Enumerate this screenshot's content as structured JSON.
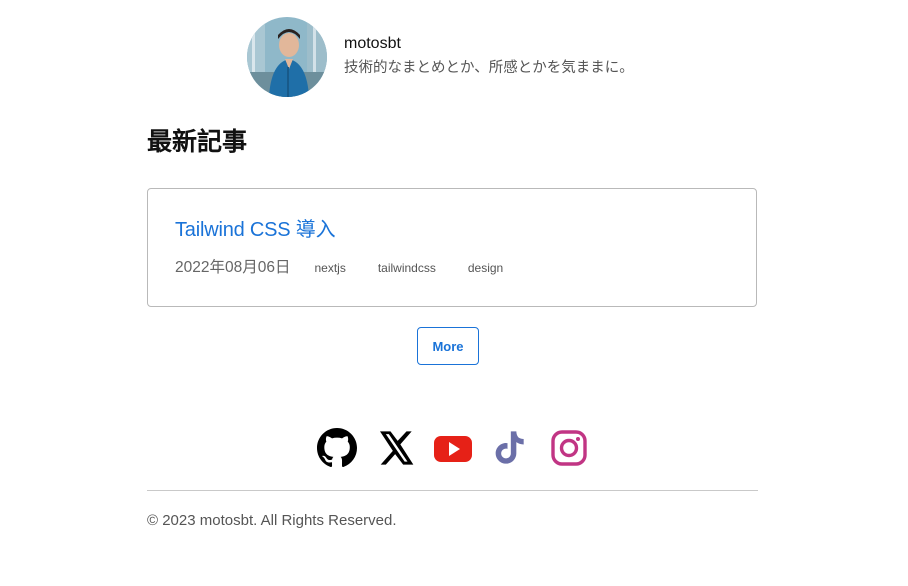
{
  "profile": {
    "name": "motosbt",
    "bio": "技術的なまとめとか、所感とかを気ままに。"
  },
  "latest": {
    "heading": "最新記事",
    "articles": [
      {
        "title": "Tailwind CSS 導入",
        "date": "2022年08月06日",
        "tags": [
          "nextjs",
          "tailwindcss",
          "design"
        ]
      }
    ],
    "more_label": "More"
  },
  "social": [
    {
      "name": "github-icon",
      "color": "#000000"
    },
    {
      "name": "x-icon",
      "color": "#000000"
    },
    {
      "name": "youtube-icon",
      "color": "#e62117"
    },
    {
      "name": "tiktok-icon",
      "color": "#6b6fa8"
    },
    {
      "name": "instagram-icon",
      "color": "#c13584"
    }
  ],
  "footer": {
    "copyright": "© 2023 motosbt. All Rights Reserved."
  },
  "colors": {
    "link": "#1a73d8",
    "border": "#b9b9b9"
  }
}
